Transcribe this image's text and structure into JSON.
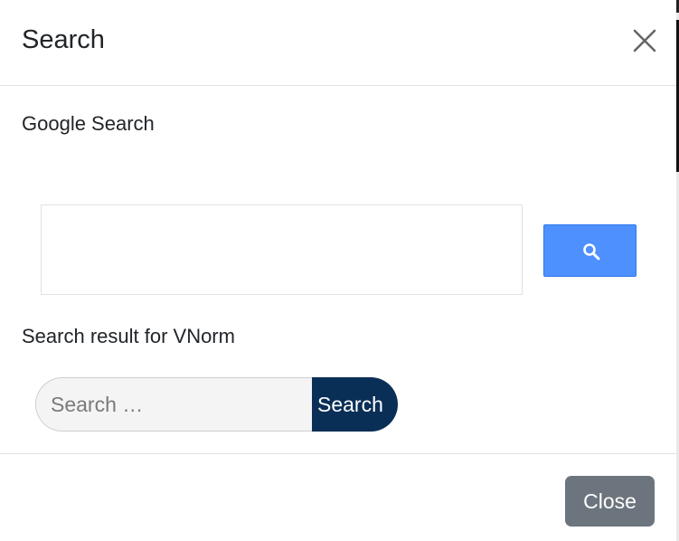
{
  "modal": {
    "title": "Search",
    "close_icon": "close-icon"
  },
  "google_search": {
    "label": "Google Search",
    "input_value": "",
    "button_icon": "search-icon",
    "button_color": "#4d90fe"
  },
  "site_search": {
    "label": "Search result for VNorm",
    "placeholder": "Search …",
    "input_value": "",
    "submit_label": "Search",
    "submit_color": "#0a2f57"
  },
  "footer": {
    "close_label": "Close",
    "close_color": "#6c757d"
  }
}
